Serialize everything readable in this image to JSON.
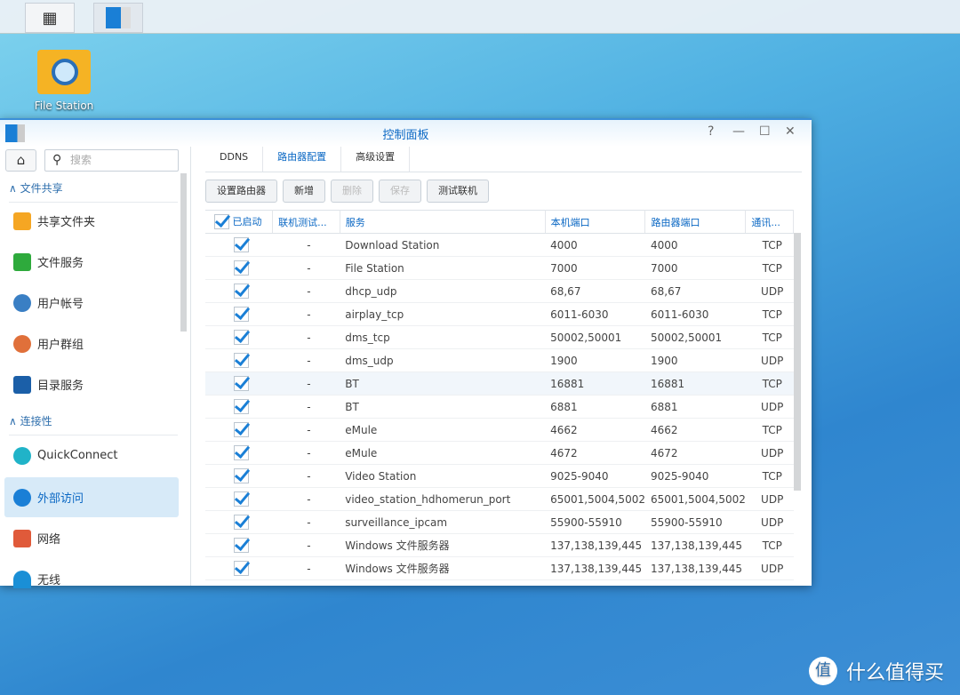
{
  "taskbar": {
    "items": [
      {
        "icon": "main-menu-icon"
      },
      {
        "icon": "control-panel-icon"
      }
    ]
  },
  "desktop": {
    "icons": [
      {
        "label": "File Station",
        "icon": "file-station-icon"
      }
    ]
  },
  "window": {
    "title": "控制面板",
    "controls": [
      "?",
      "—",
      "☐",
      "✕"
    ]
  },
  "sidebar": {
    "search_placeholder": "搜索",
    "sections": [
      {
        "label": "文件共享"
      },
      {
        "label": "连接性"
      }
    ],
    "items": [
      {
        "label": "共享文件夹",
        "color": "#f5a623"
      },
      {
        "label": "文件服务",
        "color": "#2eaa3c"
      },
      {
        "label": "用户帐号",
        "color": "#3a7fc4"
      },
      {
        "label": "用户群组",
        "color": "#e0703a"
      },
      {
        "label": "目录服务",
        "color": "#1b5fa8"
      },
      {
        "label": "QuickConnect",
        "color": "#20b3c8"
      },
      {
        "label": "外部访问",
        "color": "#1a7fd6",
        "selected": true
      },
      {
        "label": "网络",
        "color": "#e05a3a"
      },
      {
        "label": "无线",
        "color": "#1a8fd6"
      }
    ]
  },
  "tabs": [
    {
      "label": "DDNS"
    },
    {
      "label": "路由器配置",
      "active": true
    },
    {
      "label": "高级设置"
    }
  ],
  "toolbar": {
    "setup": "设置路由器",
    "add": "新增",
    "delete": "删除",
    "save": "保存",
    "test": "测试联机"
  },
  "table": {
    "headers": [
      "已启动",
      "联机测试...",
      "服务",
      "本机端口",
      "路由器端口",
      "通讯..."
    ],
    "rows": [
      {
        "enabled": true,
        "test": "-",
        "service": "Download Station",
        "local": "4000",
        "router": "4000",
        "proto": "TCP"
      },
      {
        "enabled": true,
        "test": "-",
        "service": "File Station",
        "local": "7000",
        "router": "7000",
        "proto": "TCP"
      },
      {
        "enabled": true,
        "test": "-",
        "service": "dhcp_udp",
        "local": "68,67",
        "router": "68,67",
        "proto": "UDP"
      },
      {
        "enabled": true,
        "test": "-",
        "service": "airplay_tcp",
        "local": "6011-6030",
        "router": "6011-6030",
        "proto": "TCP"
      },
      {
        "enabled": true,
        "test": "-",
        "service": "dms_tcp",
        "local": "50002,50001",
        "router": "50002,50001",
        "proto": "TCP"
      },
      {
        "enabled": true,
        "test": "-",
        "service": "dms_udp",
        "local": "1900",
        "router": "1900",
        "proto": "UDP"
      },
      {
        "enabled": true,
        "test": "-",
        "service": "BT",
        "local": "16881",
        "router": "16881",
        "proto": "TCP"
      },
      {
        "enabled": true,
        "test": "-",
        "service": "BT",
        "local": "6881",
        "router": "6881",
        "proto": "UDP"
      },
      {
        "enabled": true,
        "test": "-",
        "service": "eMule",
        "local": "4662",
        "router": "4662",
        "proto": "TCP"
      },
      {
        "enabled": true,
        "test": "-",
        "service": "eMule",
        "local": "4672",
        "router": "4672",
        "proto": "UDP"
      },
      {
        "enabled": true,
        "test": "-",
        "service": "Video Station",
        "local": "9025-9040",
        "router": "9025-9040",
        "proto": "TCP"
      },
      {
        "enabled": true,
        "test": "-",
        "service": "video_station_hdhomerun_port",
        "local": "65001,5004,5002",
        "router": "65001,5004,5002",
        "proto": "UDP"
      },
      {
        "enabled": true,
        "test": "-",
        "service": "surveillance_ipcam",
        "local": "55900-55910",
        "router": "55900-55910",
        "proto": "UDP"
      },
      {
        "enabled": true,
        "test": "-",
        "service": "Windows 文件服务器",
        "local": "137,138,139,445",
        "router": "137,138,139,445",
        "proto": "TCP"
      },
      {
        "enabled": true,
        "test": "-",
        "service": "Windows 文件服务器",
        "local": "137,138,139,445",
        "router": "137,138,139,445",
        "proto": "UDP"
      }
    ]
  },
  "watermark": {
    "logo": "值",
    "text": "什么值得买"
  }
}
